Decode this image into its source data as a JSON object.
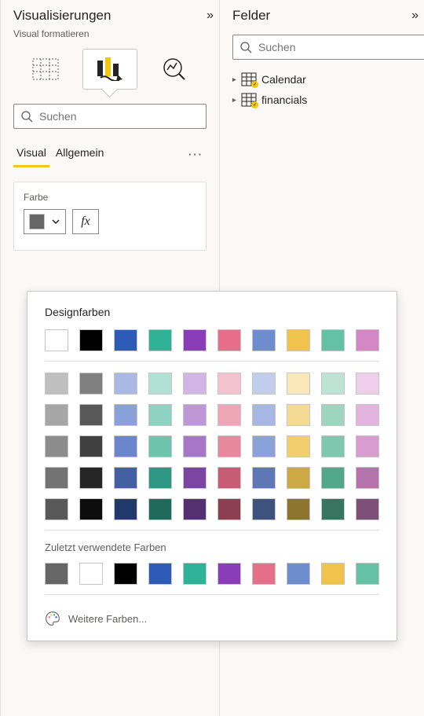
{
  "left": {
    "title": "Visualisierungen",
    "subtitle": "Visual formatieren",
    "search_placeholder": "Suchen",
    "tabs": {
      "visual": "Visual",
      "general": "Allgemein"
    },
    "farbe": {
      "label": "Farbe",
      "fx": "fx",
      "current": "#666666"
    }
  },
  "right": {
    "title": "Felder",
    "search_placeholder": "Suchen",
    "tables": [
      {
        "name": "Calendar"
      },
      {
        "name": "financials"
      }
    ]
  },
  "popover": {
    "heading": "Designfarben",
    "theme_row": [
      "#ffffff",
      "#000000",
      "#2e5bb7",
      "#30b298",
      "#8a3db8",
      "#e56f89",
      "#6d8dcf",
      "#f0c34c",
      "#65c1a3",
      "#d487c5"
    ],
    "shades": [
      [
        "#bfbfbf",
        "#808080",
        "#a9b9e3",
        "#b1e1d5",
        "#d2b5e4",
        "#f3c4cf",
        "#c0cdeb",
        "#f9e7b9",
        "#bde3d4",
        "#eeceea"
      ],
      [
        "#a6a6a6",
        "#595959",
        "#8aa0d8",
        "#8fd2c1",
        "#bd97d6",
        "#eda6b6",
        "#a5b7e2",
        "#f5da93",
        "#9ed5c1",
        "#e3b5de"
      ],
      [
        "#8c8c8c",
        "#404040",
        "#6b86cc",
        "#6ec3ad",
        "#a878c8",
        "#e7899d",
        "#8aa1d9",
        "#f2ce6e",
        "#7fc7ae",
        "#d89cd1"
      ],
      [
        "#737373",
        "#262626",
        "#4361a2",
        "#2f9884",
        "#7b46a1",
        "#c75d75",
        "#5e78b5",
        "#cca944",
        "#52a68a",
        "#b573ac"
      ],
      [
        "#595959",
        "#0d0d0d",
        "#223a6b",
        "#1f6a5b",
        "#553070",
        "#8b3f51",
        "#3e527e",
        "#8d752f",
        "#387460",
        "#7e4f78"
      ]
    ],
    "recent_label": "Zuletzt verwendete Farben",
    "recent": [
      "#666666",
      "#ffffff",
      "#000000",
      "#2e5bb7",
      "#30b298",
      "#8a3db8",
      "#e56f89",
      "#6d8dcf",
      "#f0c34c",
      "#65c1a3"
    ],
    "more": "Weitere Farben..."
  }
}
